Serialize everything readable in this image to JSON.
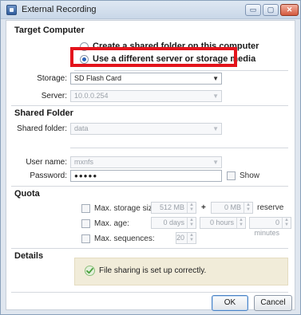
{
  "window": {
    "title": "External Recording",
    "minimize_glyph": "▭",
    "maximize_glyph": "▢",
    "close_glyph": "✕"
  },
  "target_computer": {
    "heading": "Target Computer",
    "option_shared_folder": "Create a shared folder on this computer",
    "option_different_server": "Use a different server or storage media",
    "selected": "option_different_server",
    "storage_label": "Storage:",
    "storage_value": "SD Flash Card",
    "server_label": "Server:",
    "server_value": "10.0.0.254"
  },
  "shared_folder": {
    "heading": "Shared Folder",
    "folder_label": "Shared folder:",
    "folder_value": "data",
    "user_label": "User name:",
    "user_value": "mxnfs",
    "password_label": "Password:",
    "password_value": "●●●●●",
    "show_label": "Show"
  },
  "quota": {
    "heading": "Quota",
    "max_storage_label": "Max. storage size:",
    "max_storage_value": "512 MB",
    "plus": "+",
    "reserve_value": "0 MB",
    "reserve_label": "reserve",
    "max_age_label": "Max. age:",
    "age_days": "0 days",
    "age_hours": "0 hours",
    "age_minutes": "0 minutes",
    "max_sequences_label": "Max. sequences:",
    "max_sequences_value": "20"
  },
  "details": {
    "heading": "Details",
    "status_text": "File sharing is set up correctly."
  },
  "buttons": {
    "ok": "OK",
    "cancel": "Cancel"
  },
  "colors": {
    "highlight": "#e3141c",
    "status_background": "#f1ecd9",
    "check_icon": "#4aa03a"
  }
}
